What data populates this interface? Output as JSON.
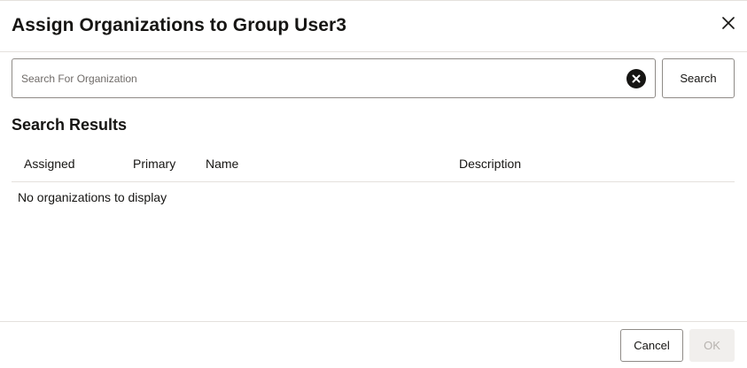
{
  "dialog": {
    "title": "Assign Organizations to Group User3",
    "close_icon": "close-icon"
  },
  "search": {
    "placeholder": "Search For Organization",
    "value": "",
    "clear_icon": "clear-circle-icon",
    "button_label": "Search"
  },
  "results": {
    "title": "Search Results",
    "columns": [
      "Assigned",
      "Primary",
      "Name",
      "Description"
    ],
    "rows": [],
    "empty_message": "No organizations to display"
  },
  "footer": {
    "cancel_label": "Cancel",
    "ok_label": "OK",
    "ok_disabled": true
  },
  "colors": {
    "text": "#161513",
    "border": "#8f8b87",
    "divider": "#e4e1dd",
    "disabled_bg": "#f1efed",
    "disabled_text": "#b7b3af"
  }
}
